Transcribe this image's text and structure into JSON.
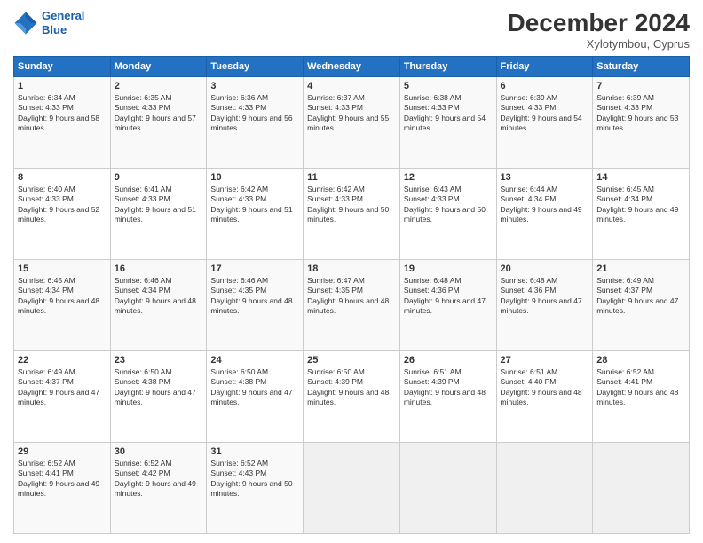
{
  "header": {
    "logo_line1": "General",
    "logo_line2": "Blue",
    "title": "December 2024",
    "subtitle": "Xylotymbou, Cyprus"
  },
  "weekdays": [
    "Sunday",
    "Monday",
    "Tuesday",
    "Wednesday",
    "Thursday",
    "Friday",
    "Saturday"
  ],
  "weeks": [
    [
      {
        "day": "1",
        "rise": "Sunrise: 6:34 AM",
        "set": "Sunset: 4:33 PM",
        "light": "Daylight: 9 hours and 58 minutes."
      },
      {
        "day": "2",
        "rise": "Sunrise: 6:35 AM",
        "set": "Sunset: 4:33 PM",
        "light": "Daylight: 9 hours and 57 minutes."
      },
      {
        "day": "3",
        "rise": "Sunrise: 6:36 AM",
        "set": "Sunset: 4:33 PM",
        "light": "Daylight: 9 hours and 56 minutes."
      },
      {
        "day": "4",
        "rise": "Sunrise: 6:37 AM",
        "set": "Sunset: 4:33 PM",
        "light": "Daylight: 9 hours and 55 minutes."
      },
      {
        "day": "5",
        "rise": "Sunrise: 6:38 AM",
        "set": "Sunset: 4:33 PM",
        "light": "Daylight: 9 hours and 54 minutes."
      },
      {
        "day": "6",
        "rise": "Sunrise: 6:39 AM",
        "set": "Sunset: 4:33 PM",
        "light": "Daylight: 9 hours and 54 minutes."
      },
      {
        "day": "7",
        "rise": "Sunrise: 6:39 AM",
        "set": "Sunset: 4:33 PM",
        "light": "Daylight: 9 hours and 53 minutes."
      }
    ],
    [
      {
        "day": "8",
        "rise": "Sunrise: 6:40 AM",
        "set": "Sunset: 4:33 PM",
        "light": "Daylight: 9 hours and 52 minutes."
      },
      {
        "day": "9",
        "rise": "Sunrise: 6:41 AM",
        "set": "Sunset: 4:33 PM",
        "light": "Daylight: 9 hours and 51 minutes."
      },
      {
        "day": "10",
        "rise": "Sunrise: 6:42 AM",
        "set": "Sunset: 4:33 PM",
        "light": "Daylight: 9 hours and 51 minutes."
      },
      {
        "day": "11",
        "rise": "Sunrise: 6:42 AM",
        "set": "Sunset: 4:33 PM",
        "light": "Daylight: 9 hours and 50 minutes."
      },
      {
        "day": "12",
        "rise": "Sunrise: 6:43 AM",
        "set": "Sunset: 4:33 PM",
        "light": "Daylight: 9 hours and 50 minutes."
      },
      {
        "day": "13",
        "rise": "Sunrise: 6:44 AM",
        "set": "Sunset: 4:34 PM",
        "light": "Daylight: 9 hours and 49 minutes."
      },
      {
        "day": "14",
        "rise": "Sunrise: 6:45 AM",
        "set": "Sunset: 4:34 PM",
        "light": "Daylight: 9 hours and 49 minutes."
      }
    ],
    [
      {
        "day": "15",
        "rise": "Sunrise: 6:45 AM",
        "set": "Sunset: 4:34 PM",
        "light": "Daylight: 9 hours and 48 minutes."
      },
      {
        "day": "16",
        "rise": "Sunrise: 6:46 AM",
        "set": "Sunset: 4:34 PM",
        "light": "Daylight: 9 hours and 48 minutes."
      },
      {
        "day": "17",
        "rise": "Sunrise: 6:46 AM",
        "set": "Sunset: 4:35 PM",
        "light": "Daylight: 9 hours and 48 minutes."
      },
      {
        "day": "18",
        "rise": "Sunrise: 6:47 AM",
        "set": "Sunset: 4:35 PM",
        "light": "Daylight: 9 hours and 48 minutes."
      },
      {
        "day": "19",
        "rise": "Sunrise: 6:48 AM",
        "set": "Sunset: 4:36 PM",
        "light": "Daylight: 9 hours and 47 minutes."
      },
      {
        "day": "20",
        "rise": "Sunrise: 6:48 AM",
        "set": "Sunset: 4:36 PM",
        "light": "Daylight: 9 hours and 47 minutes."
      },
      {
        "day": "21",
        "rise": "Sunrise: 6:49 AM",
        "set": "Sunset: 4:37 PM",
        "light": "Daylight: 9 hours and 47 minutes."
      }
    ],
    [
      {
        "day": "22",
        "rise": "Sunrise: 6:49 AM",
        "set": "Sunset: 4:37 PM",
        "light": "Daylight: 9 hours and 47 minutes."
      },
      {
        "day": "23",
        "rise": "Sunrise: 6:50 AM",
        "set": "Sunset: 4:38 PM",
        "light": "Daylight: 9 hours and 47 minutes."
      },
      {
        "day": "24",
        "rise": "Sunrise: 6:50 AM",
        "set": "Sunset: 4:38 PM",
        "light": "Daylight: 9 hours and 47 minutes."
      },
      {
        "day": "25",
        "rise": "Sunrise: 6:50 AM",
        "set": "Sunset: 4:39 PM",
        "light": "Daylight: 9 hours and 48 minutes."
      },
      {
        "day": "26",
        "rise": "Sunrise: 6:51 AM",
        "set": "Sunset: 4:39 PM",
        "light": "Daylight: 9 hours and 48 minutes."
      },
      {
        "day": "27",
        "rise": "Sunrise: 6:51 AM",
        "set": "Sunset: 4:40 PM",
        "light": "Daylight: 9 hours and 48 minutes."
      },
      {
        "day": "28",
        "rise": "Sunrise: 6:52 AM",
        "set": "Sunset: 4:41 PM",
        "light": "Daylight: 9 hours and 48 minutes."
      }
    ],
    [
      {
        "day": "29",
        "rise": "Sunrise: 6:52 AM",
        "set": "Sunset: 4:41 PM",
        "light": "Daylight: 9 hours and 49 minutes."
      },
      {
        "day": "30",
        "rise": "Sunrise: 6:52 AM",
        "set": "Sunset: 4:42 PM",
        "light": "Daylight: 9 hours and 49 minutes."
      },
      {
        "day": "31",
        "rise": "Sunrise: 6:52 AM",
        "set": "Sunset: 4:43 PM",
        "light": "Daylight: 9 hours and 50 minutes."
      },
      null,
      null,
      null,
      null
    ]
  ]
}
